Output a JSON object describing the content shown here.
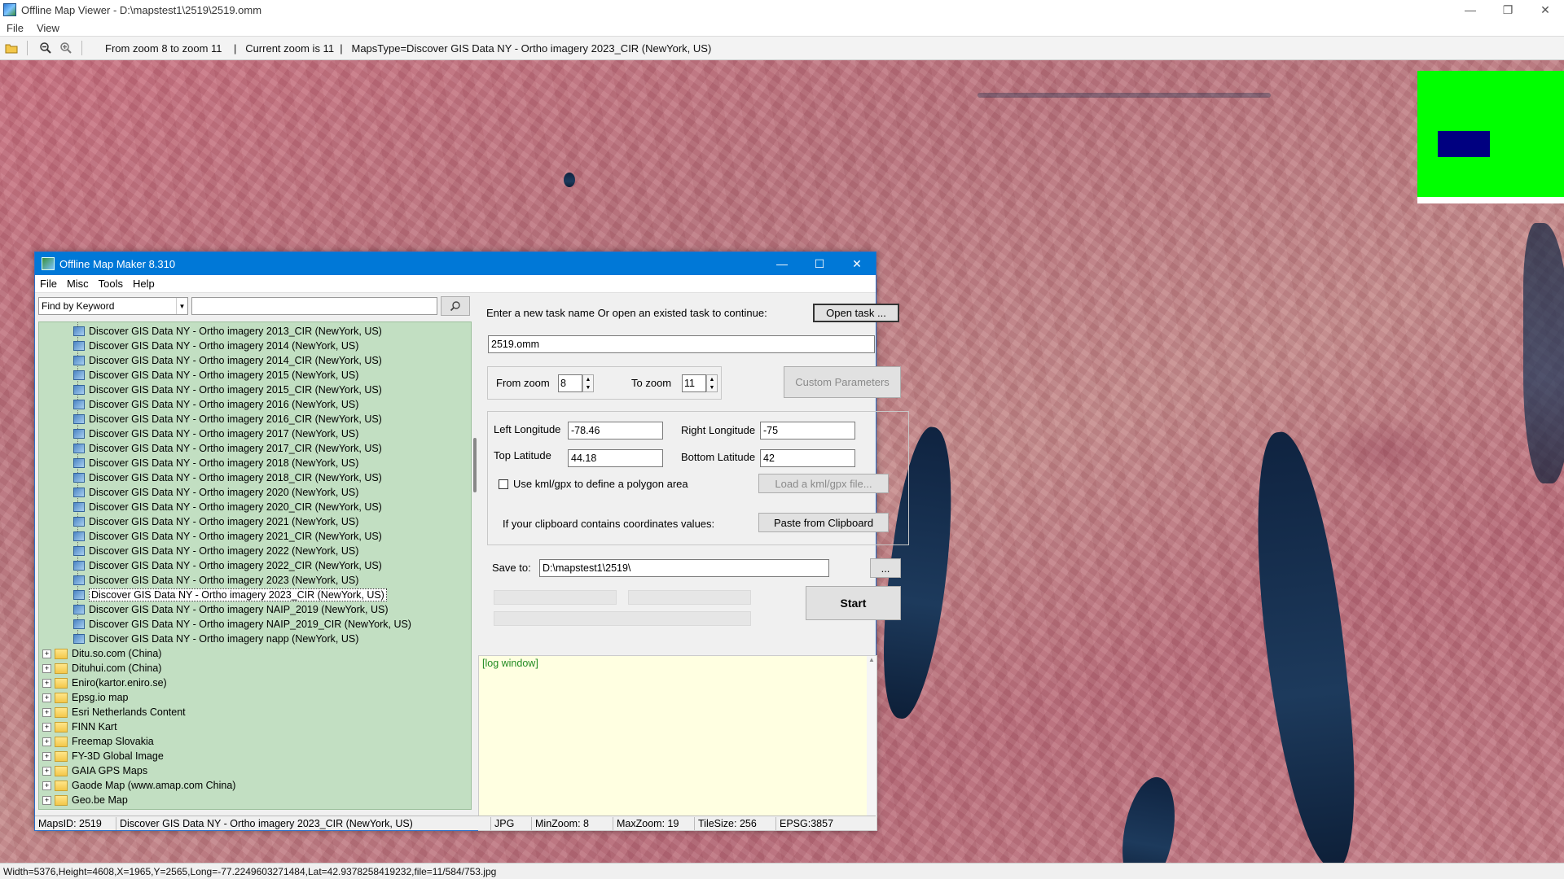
{
  "viewer": {
    "title": "Offline Map Viewer - D:\\mapstest1\\2519\\2519.omm",
    "menu": [
      "File",
      "View"
    ],
    "toolbar_info": "From zoom 8 to zoom 11    |   Current zoom is 11  |   MapsType=Discover GIS Data NY - Ortho imagery 2023_CIR (NewYork, US)",
    "status": "Width=5376,Height=4608,X=1965,Y=2565,Long=-77.2249603271484,Lat=42.9378258419232,file=11/584/753.jpg",
    "minimap_colors": {
      "background": "#00ff00",
      "viewport": "#000080"
    }
  },
  "dialog": {
    "title": "Offline Map Maker 8.310",
    "menu": [
      "File",
      "Misc",
      "Tools",
      "Help"
    ],
    "find_by": "Find by Keyword",
    "keyword_value": "",
    "tree_children": [
      "Discover GIS Data NY - Ortho imagery 2013_CIR (NewYork, US)",
      "Discover GIS Data NY - Ortho imagery 2014 (NewYork, US)",
      "Discover GIS Data NY - Ortho imagery 2014_CIR (NewYork, US)",
      "Discover GIS Data NY - Ortho imagery 2015 (NewYork, US)",
      "Discover GIS Data NY - Ortho imagery 2015_CIR (NewYork, US)",
      "Discover GIS Data NY - Ortho imagery 2016 (NewYork, US)",
      "Discover GIS Data NY - Ortho imagery 2016_CIR (NewYork, US)",
      "Discover GIS Data NY - Ortho imagery 2017 (NewYork, US)",
      "Discover GIS Data NY - Ortho imagery 2017_CIR (NewYork, US)",
      "Discover GIS Data NY - Ortho imagery 2018 (NewYork, US)",
      "Discover GIS Data NY - Ortho imagery 2018_CIR (NewYork, US)",
      "Discover GIS Data NY - Ortho imagery 2020 (NewYork, US)",
      "Discover GIS Data NY - Ortho imagery 2020_CIR (NewYork, US)",
      "Discover GIS Data NY - Ortho imagery 2021 (NewYork, US)",
      "Discover GIS Data NY - Ortho imagery 2021_CIR (NewYork, US)",
      "Discover GIS Data NY - Ortho imagery 2022 (NewYork, US)",
      "Discover GIS Data NY - Ortho imagery 2022_CIR (NewYork, US)",
      "Discover GIS Data NY - Ortho imagery 2023 (NewYork, US)",
      "Discover GIS Data NY - Ortho imagery 2023_CIR (NewYork, US)",
      "Discover GIS Data NY - Ortho imagery NAIP_2019 (NewYork, US)",
      "Discover GIS Data NY - Ortho imagery NAIP_2019_CIR (NewYork, US)",
      "Discover GIS Data NY - Ortho imagery napp (NewYork, US)"
    ],
    "selected_child": "Discover GIS Data NY - Ortho imagery 2023_CIR (NewYork, US)",
    "tree_folders": [
      "Ditu.so.com (China)",
      "Dituhui.com (China)",
      "Eniro(kartor.eniro.se)",
      "Epsg.io map",
      "Esri Netherlands Content",
      "FINN Kart",
      "Freemap Slovakia",
      "FY-3D Global Image",
      "GAIA GPS Maps",
      "Gaode Map (www.amap.com China)",
      "Geo.be Map"
    ],
    "task_prompt": "Enter a new task name Or open an existed task to continue:",
    "open_task_label": "Open task ...",
    "task_name": "2519.omm",
    "from_zoom_label": "From zoom",
    "from_zoom": "8",
    "to_zoom_label": "To zoom",
    "to_zoom": "11",
    "custom_params_label": "Custom Parameters",
    "left_lon_label": "Left Longitude",
    "left_lon": "-78.46",
    "right_lon_label": "Right Longitude",
    "right_lon": "-75",
    "top_lat_label": "Top Latitude",
    "top_lat": "44.18",
    "bottom_lat_label": "Bottom Latitude",
    "bottom_lat": "42",
    "kml_label": "Use kml/gpx to define a polygon area",
    "load_kml_label": "Load a kml/gpx file...",
    "clipboard_prompt": "If your clipboard contains coordinates values:",
    "paste_label": "Paste from Clipboard",
    "save_to_label": "Save to:",
    "save_to": "D:\\mapstest1\\2519\\",
    "browse_label": "...",
    "start_label": "Start",
    "log_text": "[log window]",
    "status": {
      "maps_id": "MapsID: 2519",
      "map_name": "Discover GIS Data NY - Ortho imagery 2023_CIR (NewYork, US)",
      "format": "JPG",
      "min_zoom": "MinZoom: 8",
      "max_zoom": "MaxZoom: 19",
      "tile_size": "TileSize: 256",
      "epsg": "EPSG:3857"
    }
  }
}
